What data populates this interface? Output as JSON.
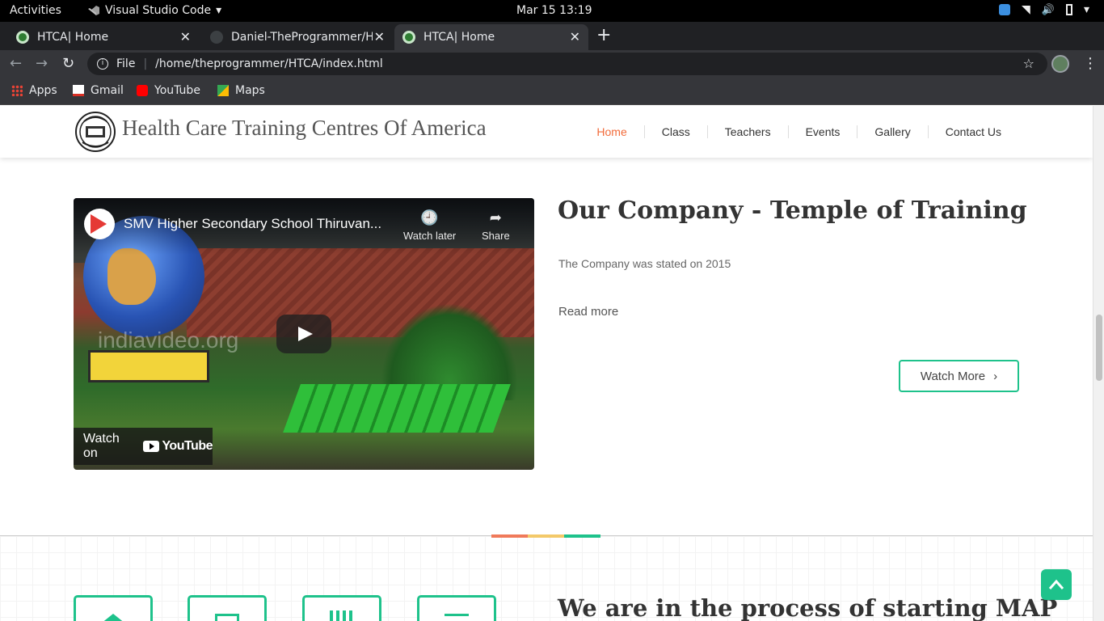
{
  "system_bar": {
    "activities": "Activities",
    "app_name": "Visual Studio Code",
    "clock": "Mar 15  13:19"
  },
  "browser": {
    "tabs": [
      {
        "label": "HTCA| Home",
        "active": false
      },
      {
        "label": "Daniel-TheProgrammer/H",
        "active": false
      },
      {
        "label": "HTCA| Home",
        "active": true
      }
    ],
    "address": {
      "scheme_label": "File",
      "url": "/home/theprogrammer/HTCA/index.html"
    },
    "bookmarks": [
      "Apps",
      "Gmail",
      "YouTube",
      "Maps"
    ]
  },
  "site": {
    "title": "Health Care Training Centres Of America",
    "nav": [
      "Home",
      "Class",
      "Teachers",
      "Events",
      "Gallery",
      "Contact Us"
    ],
    "active_nav": "Home",
    "accent_color": "#1ec28b",
    "nav_active_color": "#f26b3a"
  },
  "video": {
    "title": "SMV Higher Secondary School Thiruvan...",
    "watch_later": "Watch later",
    "share": "Share",
    "watermark": "indiavideo.org",
    "watch_on": "Watch on",
    "youtube_label": "YouTube"
  },
  "company": {
    "heading": "Our Company - Temple of Training",
    "paragraph": "The Company was stated on 2015",
    "read_more": "Read more",
    "watch_more": "Watch More"
  },
  "lower": {
    "heading": "We are in the process of starting MAP",
    "colorbar": [
      "#f07a5a",
      "#f3c969",
      "#1ec28b"
    ]
  }
}
